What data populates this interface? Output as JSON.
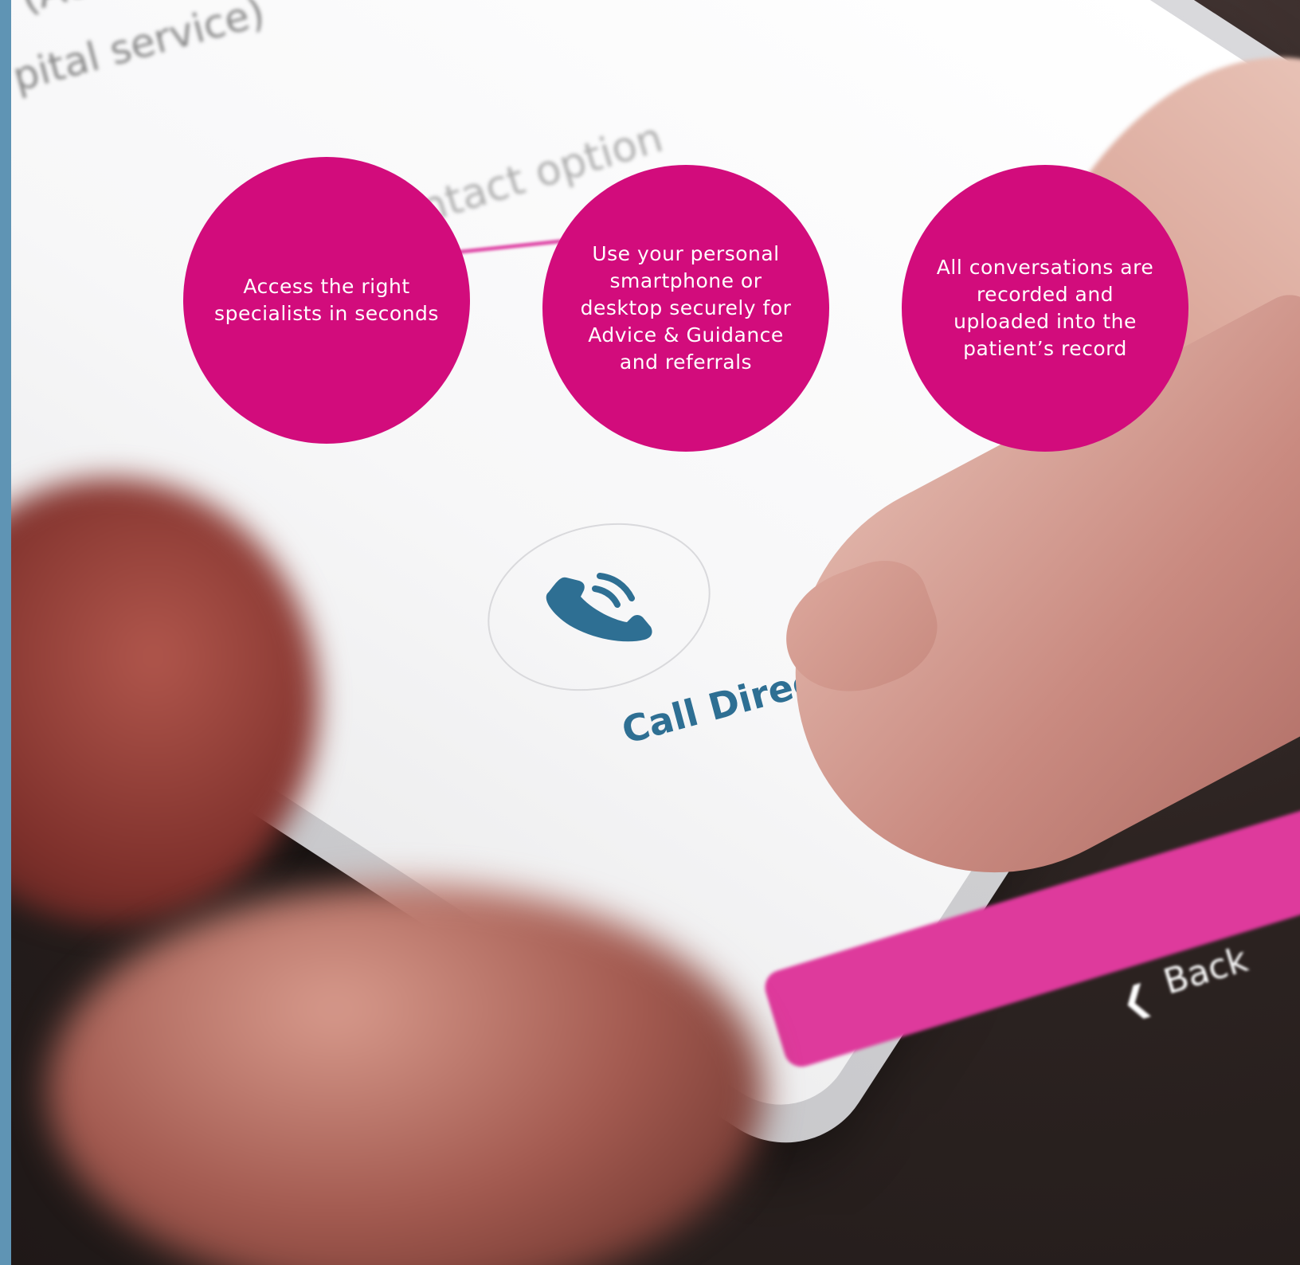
{
  "bubbles": [
    {
      "text": "Access the right specialists in seconds"
    },
    {
      "text": "Use your personal smartphone or desktop securely for Advice & Guidance and referrals"
    },
    {
      "text": "All conversations are recorded and uploaded into the patient’s record"
    }
  ],
  "screen": {
    "top_text": "(Acute ...",
    "service_text": "pital service)",
    "contact_text": "ntact option",
    "call_label": "Call Direct",
    "back_label": "Back"
  },
  "colors": {
    "bubble": "#d20c7c",
    "call_blue": "#2e6f93",
    "back_bar": "#de3a9c",
    "left_strip": "#5f94b4"
  },
  "icons": {
    "call": "phone-handset-icon",
    "back": "chevron-left-icon"
  }
}
